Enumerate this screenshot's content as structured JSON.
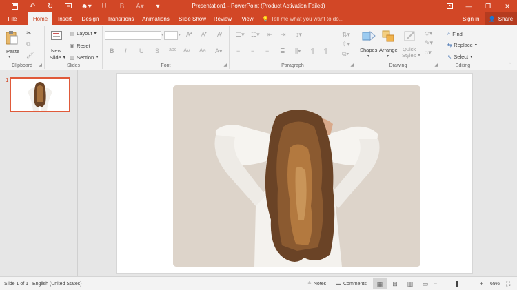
{
  "titlebar": {
    "title": "Presentation1 - PowerPoint (Product Activation Failed)",
    "qat": [
      {
        "icon": "save-icon",
        "glyph": "💾"
      },
      {
        "icon": "undo-icon",
        "glyph": "↶"
      },
      {
        "icon": "redo-icon",
        "glyph": "↻"
      },
      {
        "icon": "presenter-icon",
        "glyph": "▣"
      },
      {
        "icon": "touch-mode-icon",
        "glyph": "☻"
      },
      {
        "icon": "underline-icon",
        "glyph": "U"
      },
      {
        "icon": "bold-icon",
        "glyph": "B"
      },
      {
        "icon": "font-color-icon",
        "glyph": "A"
      },
      {
        "icon": "customize-qat-icon",
        "glyph": "▾"
      }
    ],
    "window_buttons": [
      "▣",
      "—",
      "❐",
      "✕"
    ]
  },
  "tabs": [
    "File",
    "Home",
    "Insert",
    "Design",
    "Transitions",
    "Animations",
    "Slide Show",
    "Review",
    "View"
  ],
  "active_tab": "Home",
  "tell_me": "Tell me what you want to do...",
  "sign_in": "Sign in",
  "share": "Share",
  "ribbon": {
    "clipboard": {
      "label": "Clipboard",
      "paste": "Paste"
    },
    "slides": {
      "label": "Slides",
      "new_slide": [
        "New",
        "Slide"
      ],
      "layout": "Layout",
      "reset": "Reset",
      "section": "Section"
    },
    "font": {
      "label": "Font"
    },
    "paragraph": {
      "label": "Paragraph"
    },
    "drawing": {
      "label": "Drawing",
      "shapes": "Shapes",
      "arrange": "Arrange",
      "quick_styles": [
        "Quick",
        "Styles"
      ]
    },
    "editing": {
      "label": "Editing",
      "find": "Find",
      "replace": "Replace",
      "select": "Select"
    }
  },
  "thumbnails": [
    {
      "number": "1"
    }
  ],
  "statusbar": {
    "slide": "Slide 1 of 1",
    "language": "English (United States)",
    "notes": "Notes",
    "comments": "Comments",
    "zoom": "69%",
    "zoom_value": 0.42
  },
  "colors": {
    "accent": "#d24726",
    "share_bg": "#b53b1f",
    "ribbon_bg": "#f3f3f3",
    "canvas_bg": "#e6e6e6",
    "photo_bg": "#ddd4ca"
  }
}
